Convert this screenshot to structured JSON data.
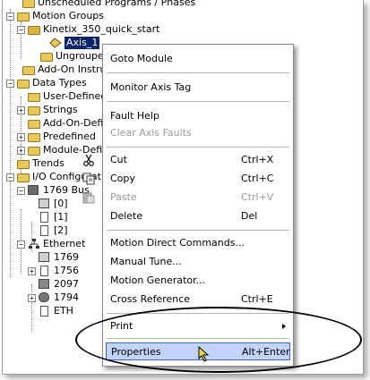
{
  "tree": {
    "items": [
      {
        "label": "Unscheduled Programs / Phases",
        "icon": "folder-icon"
      },
      {
        "label": "Motion Groups",
        "icon": "folder-icon",
        "expander": "−"
      },
      {
        "label": "Kinetix_350_quick_start",
        "icon": "motion-group-icon",
        "expander": "−"
      },
      {
        "label": "Axis_1",
        "icon": "axis-icon"
      },
      {
        "label": "Ungrouped Axes",
        "icon": "folder-icon"
      },
      {
        "label": "Add-On Instructions",
        "icon": "folder-icon"
      },
      {
        "label": "Data Types",
        "icon": "folder-icon",
        "expander": "−"
      },
      {
        "label": "User-Defined",
        "icon": "folder-icon"
      },
      {
        "label": "Strings",
        "icon": "folder-icon",
        "expander": "+"
      },
      {
        "label": "Add-On-Defined",
        "icon": "folder-icon"
      },
      {
        "label": "Predefined",
        "icon": "folder-icon",
        "expander": "+"
      },
      {
        "label": "Module-Defined",
        "icon": "folder-icon",
        "expander": "+"
      },
      {
        "label": "Trends",
        "icon": "folder-icon"
      },
      {
        "label": "I/O Configuration",
        "icon": "folder-icon",
        "expander": "−"
      },
      {
        "label": "1769 Bus",
        "icon": "bus-icon",
        "expander": "−"
      },
      {
        "label": "[0]",
        "icon": "module-icon"
      },
      {
        "label": "[1]",
        "icon": "slot-icon"
      },
      {
        "label": "[2]",
        "icon": "slot-icon"
      },
      {
        "label": "Ethernet",
        "icon": "network-icon",
        "expander": "−"
      },
      {
        "label": "1769",
        "icon": "module-icon"
      },
      {
        "label": "1756",
        "icon": "slot-icon",
        "expander": "+"
      },
      {
        "label": "2097",
        "icon": "drive-icon"
      },
      {
        "label": "1794",
        "icon": "adapter-icon",
        "expander": "+"
      },
      {
        "label": "ETH",
        "icon": "slot-icon"
      }
    ]
  },
  "menu": {
    "items": [
      {
        "label": "Goto Module",
        "shortcut": "",
        "disabled": false
      },
      {
        "label": "Monitor Axis Tag",
        "shortcut": "",
        "disabled": false
      },
      {
        "label": "Fault Help",
        "shortcut": "",
        "disabled": false
      },
      {
        "label": "Clear Axis Faults",
        "shortcut": "",
        "disabled": true
      },
      {
        "label": "Cut",
        "shortcut": "Ctrl+X",
        "disabled": false,
        "icon": "scissors-icon"
      },
      {
        "label": "Copy",
        "shortcut": "Ctrl+C",
        "disabled": false,
        "icon": "copy-icon"
      },
      {
        "label": "Paste",
        "shortcut": "Ctrl+V",
        "disabled": true,
        "icon": "paste-icon"
      },
      {
        "label": "Delete",
        "shortcut": "Del",
        "disabled": false
      },
      {
        "label": "Motion Direct Commands...",
        "shortcut": "",
        "disabled": false
      },
      {
        "label": "Manual Tune...",
        "shortcut": "",
        "disabled": false
      },
      {
        "label": "Motion Generator...",
        "shortcut": "",
        "disabled": false
      },
      {
        "label": "Cross Reference",
        "shortcut": "Ctrl+E",
        "disabled": false
      },
      {
        "label": "Print",
        "shortcut": "",
        "disabled": false,
        "submenu": true
      },
      {
        "label": "Properties",
        "shortcut": "Alt+Enter",
        "disabled": false,
        "highlighted": true
      }
    ]
  },
  "colors": {
    "selection": "#0a246a",
    "menu_highlight": "#c2d3fc",
    "folder": "#e8c85a"
  }
}
